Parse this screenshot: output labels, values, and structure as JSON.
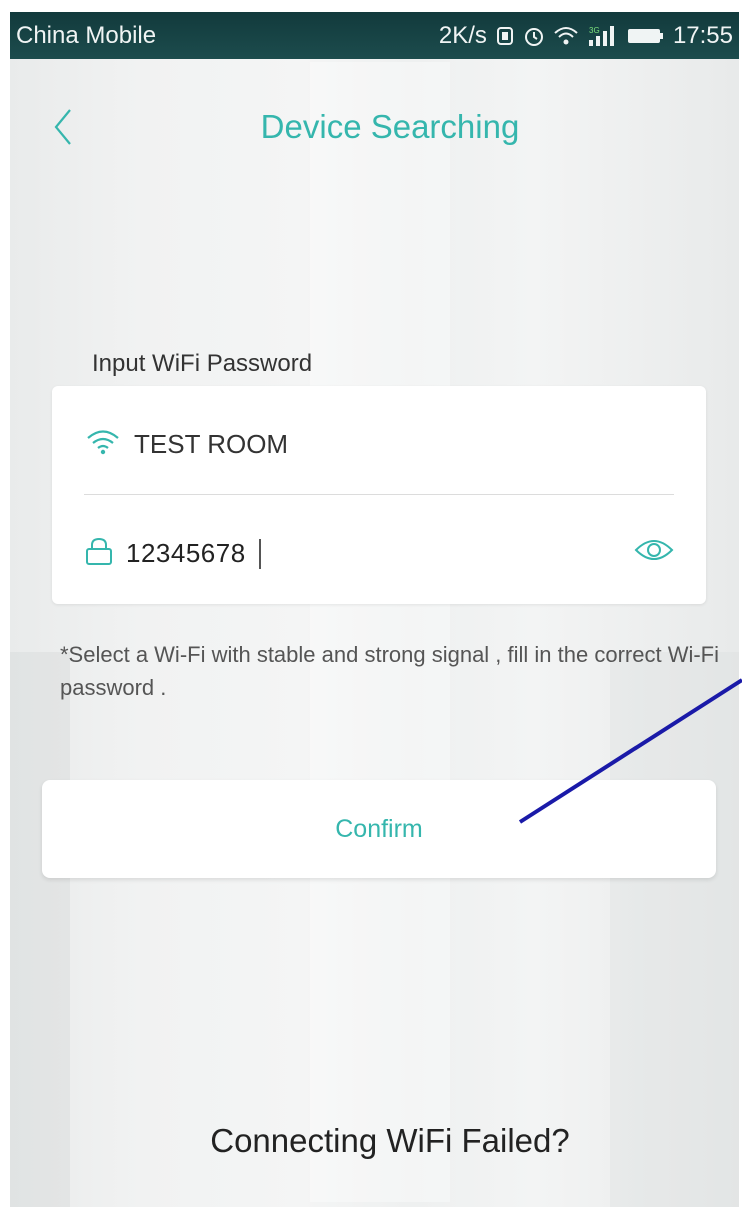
{
  "status_bar": {
    "carrier": "China Mobile",
    "speed": "2K/s",
    "time": "17:55"
  },
  "nav": {
    "title": "Device Searching",
    "back_icon": "chevron-left-icon"
  },
  "form": {
    "section_label": "Input WiFi Password",
    "ssid": "TEST ROOM",
    "password": "12345678",
    "wifi_icon": "wifi-icon",
    "lock_icon": "lock-icon",
    "eye_icon": "eye-icon"
  },
  "hint": "*Select a Wi-Fi with stable and strong signal , fill in the correct Wi-Fi password .",
  "confirm_label": "Confirm",
  "footer_link": "Connecting WiFi Failed?",
  "colors": {
    "accent": "#35b6ad",
    "status_bar": "#1c4c4d",
    "annotation": "#1a1aa8"
  }
}
